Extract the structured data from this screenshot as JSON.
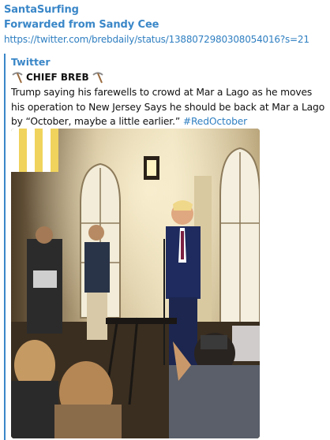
{
  "message": {
    "channel_name": "SantaSurfing",
    "forwarded_from": "Forwarded from Sandy Cee",
    "link": "https://twitter.com/brebdaily/status/1388072980308054016?s=21"
  },
  "preview": {
    "site_name": "Twitter",
    "author": {
      "name": "CHIEF BREB",
      "left_emoji": "pick-icon",
      "right_emoji": "pick-icon"
    },
    "description": "Trump saying his farewells to crowd at Mar a Lago as he moves his operation to New Jersey Says he should be back at Mar a Lago by “October, maybe a little earlier.” ",
    "hashtag": "#RedOctober",
    "media": {
      "type": "video-thumbnail"
    }
  },
  "colors": {
    "accent": "#3a87c8",
    "link": "#2f7fc1",
    "text": "#111111"
  }
}
